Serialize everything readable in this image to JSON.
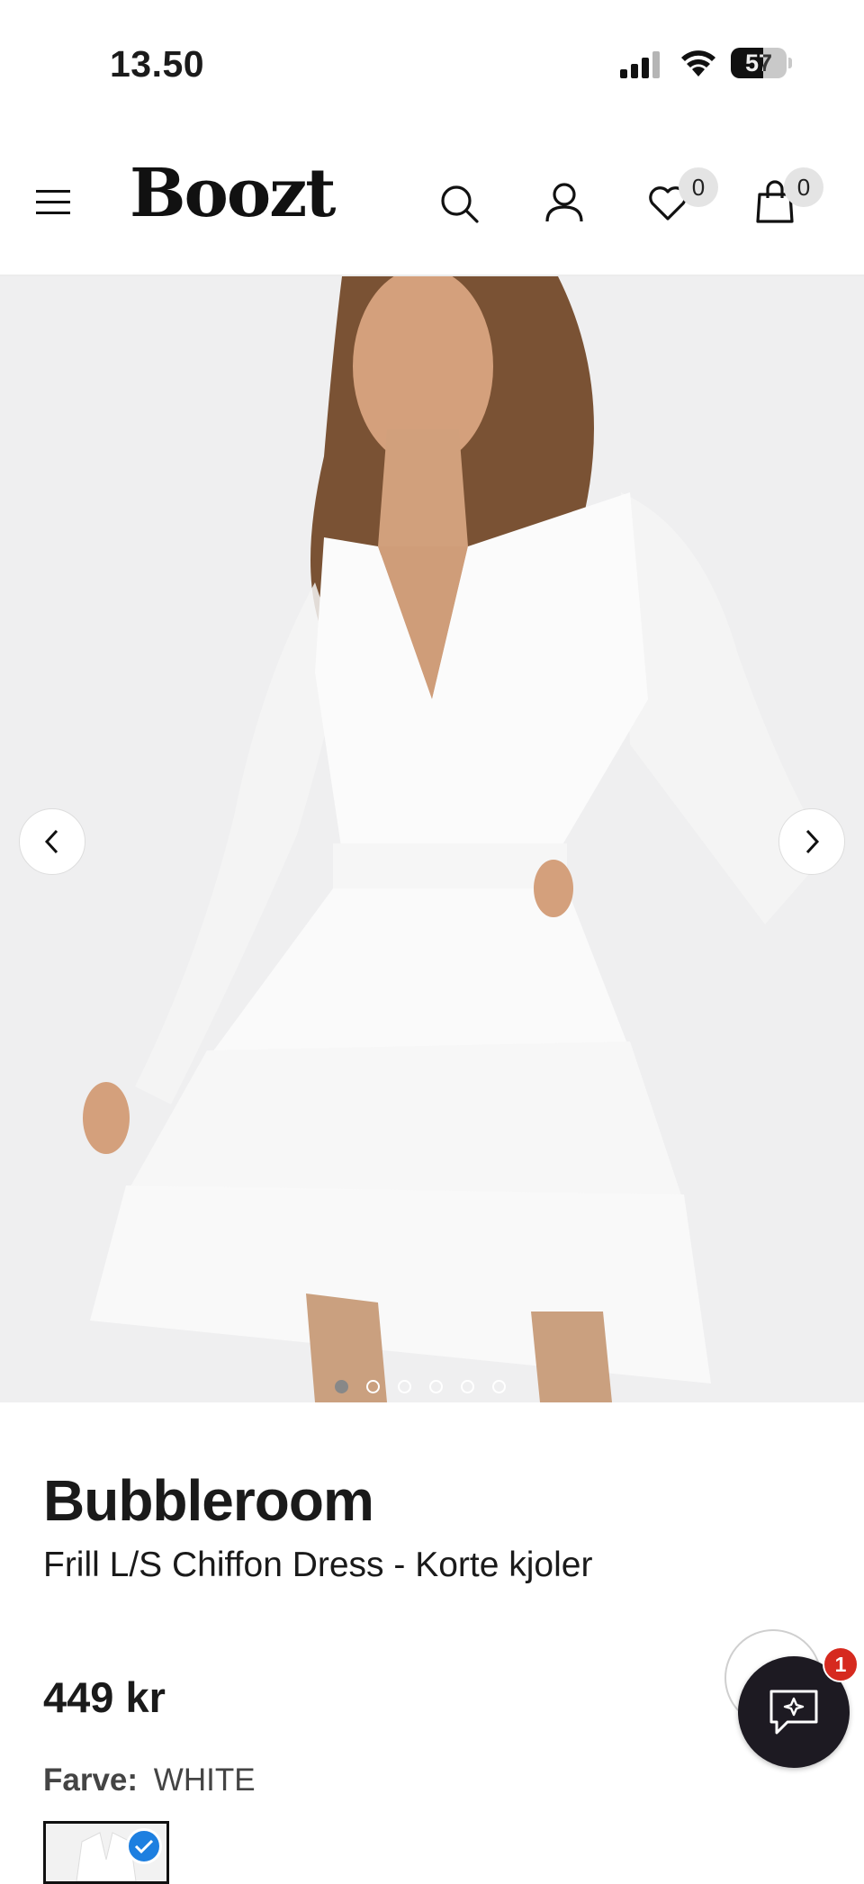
{
  "status_bar": {
    "time": "13.50",
    "battery": "57"
  },
  "header": {
    "logo": "Boozt",
    "wishlist_count": "0",
    "cart_count": "0"
  },
  "gallery": {
    "image_count": 6,
    "active_index": 0
  },
  "product": {
    "brand": "Bubbleroom",
    "name": "Frill L/S Chiffon Dress - Korte kjoler",
    "price": "449 kr",
    "color_label": "Farve:",
    "color_value": "WHITE"
  },
  "chat": {
    "badge": "1"
  },
  "colors": {
    "accent_check": "#1d7fe0",
    "badge_red": "#d62a1f",
    "chat_bg": "#1d1a22"
  }
}
